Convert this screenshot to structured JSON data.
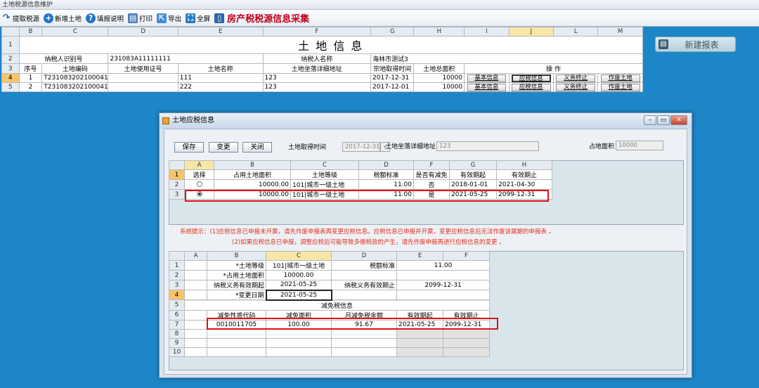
{
  "window_title": "土地税源信息维护",
  "toolbar": {
    "items": [
      "提取税源",
      "新增土地",
      "填报说明",
      "打印",
      "导出",
      "全屏"
    ],
    "title": "房产税税源信息采集"
  },
  "top_sheet": {
    "col_letters": [
      "B",
      "C",
      "D",
      "E",
      "F",
      "G",
      "H",
      "I",
      "J",
      "L",
      "M"
    ],
    "row_numbers": [
      "1",
      "2",
      "3",
      "4",
      "5"
    ],
    "title": "土 地 信 息",
    "taxpayer_id_label": "纳税人识别号",
    "taxpayer_id": "231083A11111111",
    "taxpayer_name_label": "纳税人名称",
    "taxpayer_name": "海林市测试3",
    "headers": [
      "序号",
      "土地编码",
      "土地使用证号",
      "土地名称",
      "土地坐落详细地址",
      "宗地取得时间",
      "土地总面积",
      "操    作"
    ],
    "rows": [
      {
        "seq": "1",
        "code": "T23108320210004153",
        "cert": "",
        "name": "111",
        "addr": "123",
        "date": "2017-12-31",
        "area": "10000"
      },
      {
        "seq": "2",
        "code": "T23108320210004154",
        "cert": "",
        "name": "222",
        "addr": "123",
        "date": "2017-12-01",
        "area": "10000"
      }
    ],
    "action_labels": [
      "基本信息",
      "应税信息",
      "义务终止",
      "作废土地"
    ]
  },
  "new_report_label": "新建报表",
  "dialog": {
    "title": "土地应税信息",
    "save": "保存",
    "change": "变更",
    "close": "关闭",
    "acq_time_label": "土地取得时间",
    "acq_time_value": "2017-12-31",
    "addr_label": "土地坐落详细地址",
    "addr_value": "123",
    "area_label": "占地面积",
    "area_value": "10000",
    "grid1": {
      "col_letters": [
        "A",
        "B",
        "C",
        "D",
        "F",
        "G",
        "H"
      ],
      "row_numbers": [
        "1",
        "2",
        "3"
      ],
      "headers": [
        "选择",
        "占用土地面积",
        "土地等级",
        "税额标准",
        "是否有减免",
        "有效期起",
        "有效期止"
      ],
      "rows": [
        {
          "area": "10000.00",
          "grade": "101|城市一级土地",
          "std": "11.00",
          "relief": "否",
          "start": "2018-01-01",
          "end": "2021-04-30",
          "selected": false
        },
        {
          "area": "10000.00",
          "grade": "101|城市一级土地",
          "std": "11.00",
          "relief": "是",
          "start": "2021-05-25",
          "end": "2099-12-31",
          "selected": true
        }
      ]
    },
    "hint1": "系统提示：(1)应税信息已申报未开票，请先作废申报表再变更应税信息。应税信息已申报并开票，变更应税信息后无法作废该属期的申报表 。",
    "hint2": "(2)如果应税信息已申报，调整应税后可能导致多缴税款的产生，请先作废申报再进行应税信息的变更 。",
    "grid2": {
      "col_letters": [
        "A",
        "B",
        "C",
        "D",
        "E",
        "F"
      ],
      "row_numbers": [
        "1",
        "2",
        "3",
        "4",
        "5",
        "6",
        "7",
        "8",
        "9",
        "10"
      ],
      "grade_label": "*土地等级",
      "grade_value": "101|城市一级土地",
      "std_label": "税额标准",
      "std_value": "11.00",
      "area_label": "*占用土地面积",
      "area_value": "10000.00",
      "oblig_start_label": "纳税义务有效期起",
      "oblig_start_value": "2021-05-25",
      "oblig_end_label": "纳税义务有效期止",
      "oblig_end_value": "2099-12-31",
      "change_date_label": "*变更日期",
      "change_date_value": "2021-05-25",
      "relief_title": "减免税信息",
      "relief_headers": [
        "减免性质代码",
        "减免面积",
        "月减免税金额",
        "有效期起",
        "有效期止"
      ],
      "relief_row": {
        "code": "0010011705",
        "area": "100.00",
        "amount": "91.67",
        "start": "2021-05-25",
        "end": "2099-12-31"
      }
    }
  }
}
